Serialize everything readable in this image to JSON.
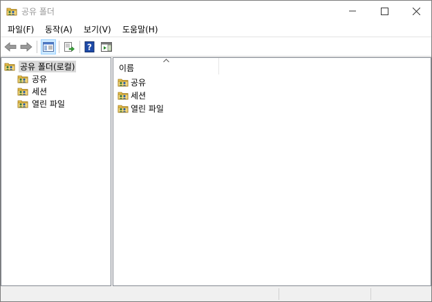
{
  "window": {
    "title": "공유 폴더",
    "title_icon": "shared-folder-icon"
  },
  "menu": [
    {
      "label": "파일(F)"
    },
    {
      "label": "동작(A)"
    },
    {
      "label": "보기(V)"
    },
    {
      "label": "도움말(H)"
    }
  ],
  "tree": {
    "root": {
      "label": "공유 폴더(로컬)",
      "icon": "shared-folder-icon"
    },
    "children": [
      {
        "label": "공유",
        "icon": "shared-folder-icon"
      },
      {
        "label": "세션",
        "icon": "shared-folder-icon"
      },
      {
        "label": "열린 파일",
        "icon": "shared-folder-icon"
      }
    ]
  },
  "list": {
    "column": "이름",
    "items": [
      {
        "label": "공유",
        "icon": "shared-folder-icon"
      },
      {
        "label": "세션",
        "icon": "shared-folder-icon"
      },
      {
        "label": "열린 파일",
        "icon": "shared-folder-icon"
      }
    ]
  },
  "colors": {
    "selection": "#d9d9d9",
    "toolbar_active": "#cce8ff",
    "help_icon": "#1d4aa8"
  }
}
